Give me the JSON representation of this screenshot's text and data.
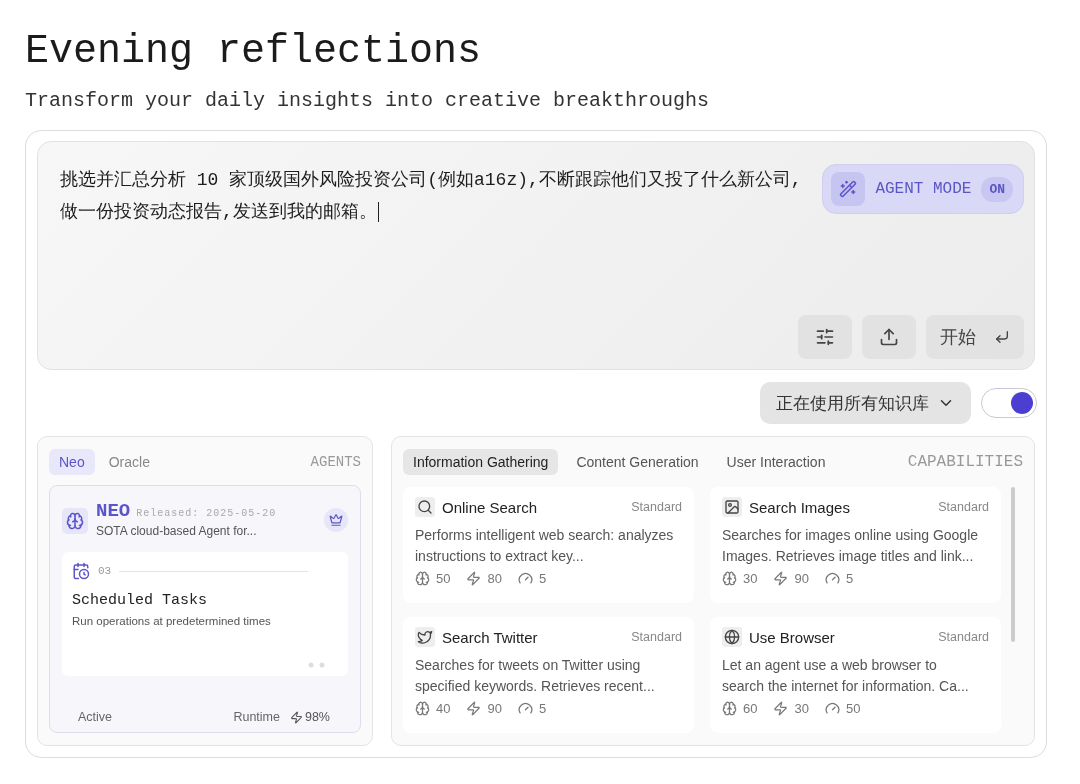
{
  "header": {
    "title": "Evening reflections",
    "subtitle": "Transform your daily insights into creative breakthroughs"
  },
  "prompt": {
    "value": "挑选并汇总分析 10 家顶级国外风险投资公司(例如a16z),不断跟踪他们又投了什么新公司,做一份投资动态报告,发送到我的邮箱。",
    "agent_mode": {
      "label": "AGENT MODE",
      "state": "ON",
      "on": true
    },
    "start_button": "开始"
  },
  "knowledge": {
    "label": "正在使用所有知识库",
    "on": true
  },
  "agents": {
    "tabs": [
      {
        "label": "Neo",
        "selected": true
      },
      {
        "label": "Oracle",
        "selected": false
      }
    ],
    "heading": "AGENTS",
    "card": {
      "name": "NEO",
      "released": "Released: 2025-05-20",
      "description": "SOTA cloud-based Agent for...",
      "feature": {
        "number": "03",
        "title": "Scheduled Tasks",
        "description": "Run operations at predetermined times"
      },
      "status": "Active",
      "runtime_label": "Runtime",
      "runtime": "98%"
    }
  },
  "capabilities": {
    "tabs": [
      {
        "label": "Information Gathering",
        "selected": true
      },
      {
        "label": "Content Generation",
        "selected": false
      },
      {
        "label": "User Interaction",
        "selected": false
      }
    ],
    "heading": "CAPABILITIES",
    "items": [
      {
        "kind": "search",
        "title": "Online Search",
        "tier": "Standard",
        "description": "Performs intelligent web search: analyzes instructions to extract key...",
        "stats": [
          "50",
          "80",
          "5"
        ]
      },
      {
        "kind": "image",
        "title": "Search Images",
        "tier": "Standard",
        "description": "Searches for images online using Google Images. Retrieves image titles and link...",
        "stats": [
          "30",
          "90",
          "5"
        ]
      },
      {
        "kind": "twitter",
        "title": "Search Twitter",
        "tier": "Standard",
        "description": "Searches for tweets on Twitter using specified keywords. Retrieves recent...",
        "stats": [
          "40",
          "90",
          "5"
        ]
      },
      {
        "kind": "globe",
        "title": "Use Browser",
        "tier": "Standard",
        "description": "Let an agent use a web browser to search the internet for information. Ca...",
        "stats": [
          "60",
          "30",
          "50"
        ]
      }
    ]
  }
}
